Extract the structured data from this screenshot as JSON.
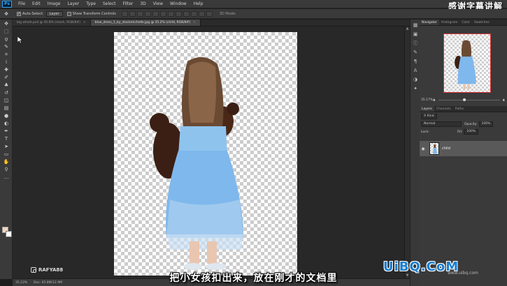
{
  "app": {
    "logo": "Ps"
  },
  "menu": [
    "File",
    "Edit",
    "Image",
    "Layer",
    "Type",
    "Select",
    "Filter",
    "3D",
    "View",
    "Window",
    "Help"
  ],
  "overlay_title": "感谢字幕讲解",
  "options_bar": {
    "auto_select_label": "Auto-Select:",
    "auto_select_value": "Layer",
    "show_transform_label": "Show Transform Controls",
    "mode_3d_label": "3D Mode:"
  },
  "tabs": [
    {
      "label": "big whale.psd @ 45.8% (mesh, RGB/8#)",
      "active": false
    },
    {
      "label": "blue_dress_1_by_stockmichelle.jpg @ 35.2% (child, RGB/8#)",
      "active": true
    }
  ],
  "watermark": "RAFYA88",
  "status": {
    "zoom": "35.23%",
    "doc": "Doc: 65.8M/12.9M"
  },
  "navigator": {
    "tabs": [
      "Navigator",
      "Histogram",
      "Color",
      "Swatches"
    ],
    "zoom": "35.17%"
  },
  "layers": {
    "tabs": [
      "Layers",
      "Channels",
      "Paths"
    ],
    "kind_label": "Kind",
    "blend_mode": "Normal",
    "opacity_label": "Opacity:",
    "opacity_value": "100%",
    "lock_label": "Lock:",
    "fill_label": "Fill:",
    "fill_value": "100%",
    "layer_name": "child"
  },
  "subtitle": "把小女孩扣出来，放在刚才的文档里",
  "logo": {
    "text": "UiBQ.CoM",
    "url": "www.uibq.com"
  },
  "colors": {
    "foreground": "#f3d6bd",
    "background": "#ffffff",
    "dress": "#7fb8ec"
  }
}
